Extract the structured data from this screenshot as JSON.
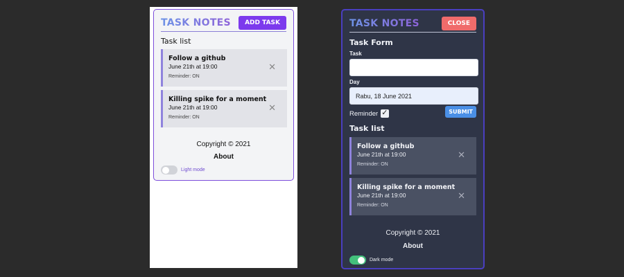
{
  "light": {
    "title": "TASK NOTES",
    "header_button": "ADD TASK",
    "list_title": "Task list",
    "tasks": [
      {
        "title": "Follow a github",
        "date": "June 21th at 19:00",
        "reminder": "Reminder: ON"
      },
      {
        "title": "Killing spike for a moment",
        "date": "June 21th at 19:00",
        "reminder": "Reminder: ON"
      }
    ],
    "copyright": "Copyright © 2021",
    "about": "About",
    "mode_label": "Light mode"
  },
  "dark": {
    "title": "TASK NOTES",
    "header_button": "CLOSE",
    "form_title": "Task Form",
    "task_label": "Task",
    "task_value": "",
    "day_label": "Day",
    "day_value": "Rabu, 18 June 2021",
    "reminder_label": "Reminder",
    "reminder_checked": true,
    "submit_label": "SUBMIT",
    "list_title": "Task list",
    "tasks": [
      {
        "title": "Follow a github",
        "date": "June 21th at 19:00",
        "reminder": "Reminder: ON"
      },
      {
        "title": "Killing spike for a moment",
        "date": "June 21th at 19:00",
        "reminder": "Reminder: ON"
      }
    ],
    "copyright": "Copyright © 2021",
    "about": "About",
    "mode_label": "Dark mode"
  },
  "icons": {
    "delete": "close-x-icon",
    "check": "checkmark-icon"
  },
  "colors": {
    "background": "#2b2b2b",
    "light_card": "#f3f4f6",
    "dark_card": "#2f3547",
    "accent_purple": "#7c3aed",
    "close_red": "#f06b6b",
    "submit_blue": "#4a8fe6",
    "toggle_on": "#43c07c",
    "task_border": "#8f83dd"
  }
}
